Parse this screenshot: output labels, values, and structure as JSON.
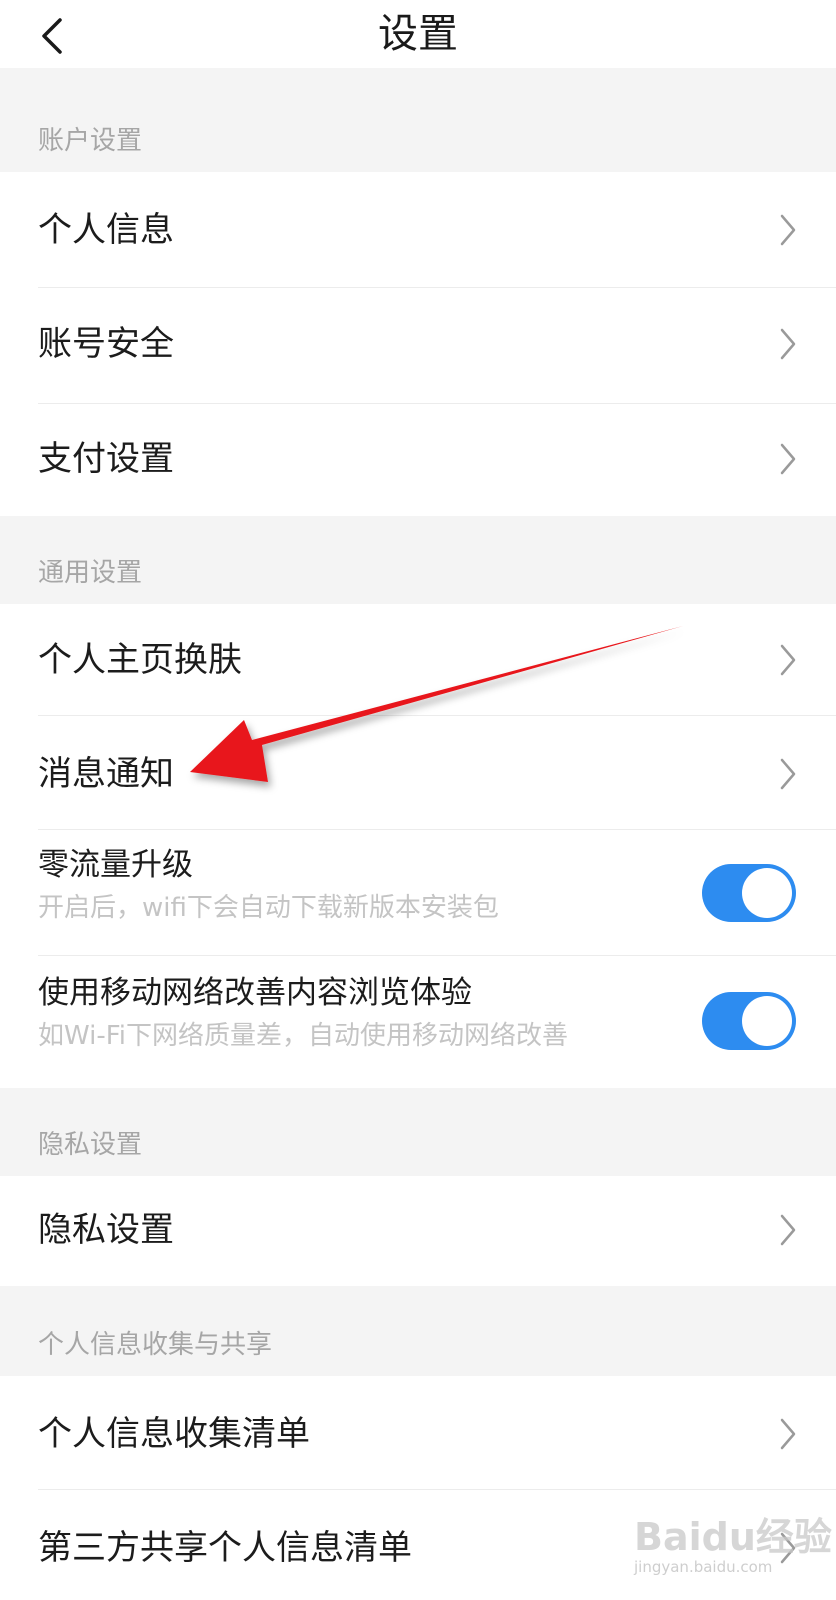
{
  "nav": {
    "title": "设置"
  },
  "sections": {
    "account": "账户设置",
    "general": "通用设置",
    "privacy": "隐私设置",
    "personal_info": "个人信息收集与共享"
  },
  "rows": {
    "personal_info": "个人信息",
    "account_security": "账号安全",
    "payment_settings": "支付设置",
    "homepage_skin": "个人主页换肤",
    "message_notify": "消息通知",
    "zero_traffic_title": "零流量升级",
    "zero_traffic_sub": "开启后，wifi下会自动下载新版本安装包",
    "mobile_network_title": "使用移动网络改善内容浏览体验",
    "mobile_network_sub": "如Wi-Fi下网络质量差，自动使用移动网络改善",
    "privacy_settings": "隐私设置",
    "info_collection_list": "个人信息收集清单",
    "third_party_list": "第三方共享个人信息清单"
  },
  "toggles": {
    "zero_traffic_on": true,
    "mobile_network_on": true
  },
  "colors": {
    "toggle_on": "#2d8cf0",
    "annotation_arrow": "#e8191c"
  },
  "watermark": {
    "logo": "Baidu经验",
    "url": "jingyan.baidu.com"
  }
}
